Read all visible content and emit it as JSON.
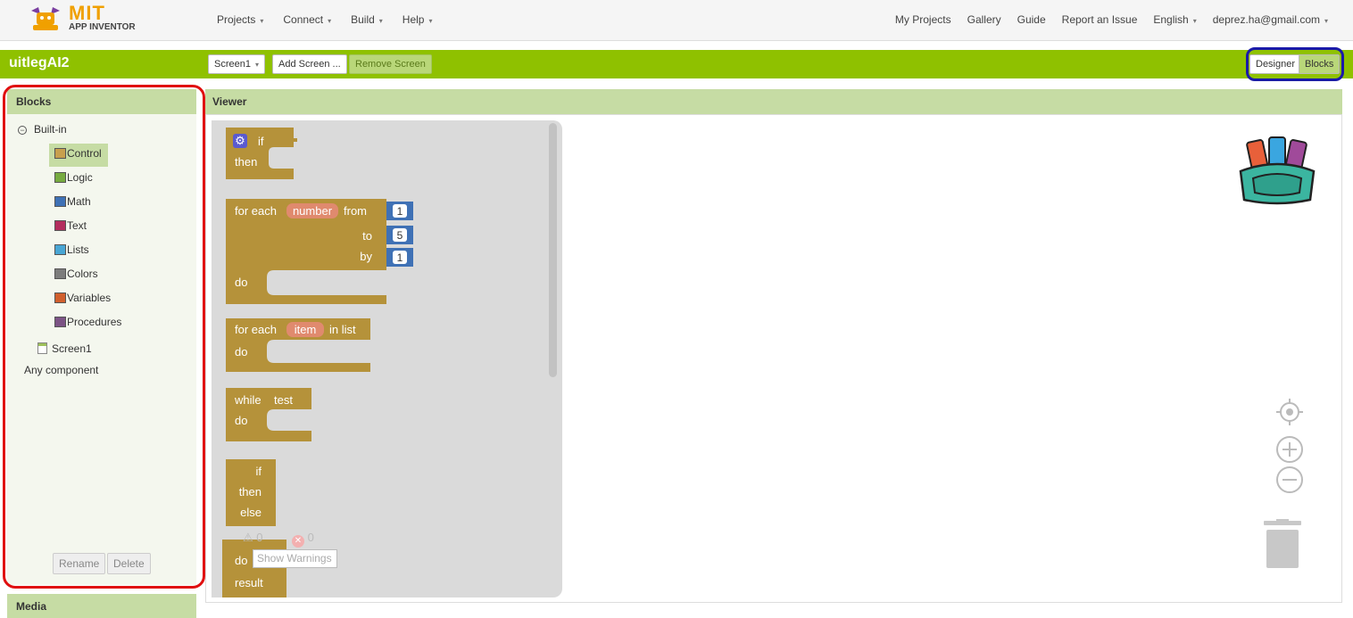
{
  "logo": {
    "mit": "MIT",
    "sub": "APP INVENTOR"
  },
  "nav_left": [
    "Projects",
    "Connect",
    "Build",
    "Help"
  ],
  "nav_right": {
    "my_projects": "My Projects",
    "gallery": "Gallery",
    "guide": "Guide",
    "report": "Report an Issue",
    "language": "English",
    "account": "deprez.ha@gmail.com"
  },
  "project": {
    "name": "uitlegAI2",
    "screen_select": "Screen1",
    "add_screen": "Add Screen ...",
    "remove_screen": "Remove Screen",
    "designer": "Designer",
    "blocks": "Blocks"
  },
  "blocks_panel": {
    "header": "Blocks",
    "root": "Built-in",
    "categories": [
      {
        "label": "Control",
        "color": "#c8a04e",
        "selected": true
      },
      {
        "label": "Logic",
        "color": "#77ab41"
      },
      {
        "label": "Math",
        "color": "#3f71b5"
      },
      {
        "label": "Text",
        "color": "#b32d5e"
      },
      {
        "label": "Lists",
        "color": "#49a6d4"
      },
      {
        "label": "Colors",
        "color": "#7d7d7d"
      },
      {
        "label": "Variables",
        "color": "#d05f2d"
      },
      {
        "label": "Procedures",
        "color": "#7c5385"
      }
    ],
    "screen": "Screen1",
    "any_component": "Any component",
    "rename": "Rename",
    "delete": "Delete"
  },
  "media_header": "Media",
  "viewer": {
    "header": "Viewer",
    "warnings_count": "0",
    "errors_count": "0",
    "show_warnings": "Show Warnings"
  },
  "blocks": {
    "if": "if",
    "then": "then",
    "for_each": "for each",
    "number_var": "number",
    "from": "from",
    "to": "to",
    "by": "by",
    "do": "do",
    "from_val": "1",
    "to_val": "5",
    "by_val": "1",
    "item_var": "item",
    "in_list": "in list",
    "while": "while",
    "test": "test",
    "else": "else",
    "result": "result"
  },
  "colors": {
    "green_bar": "#8fc100",
    "header_green": "#c6dca4",
    "control_block": "#b5923a",
    "math_block": "#3f71b5",
    "variable_pill": "#e08a6e"
  }
}
